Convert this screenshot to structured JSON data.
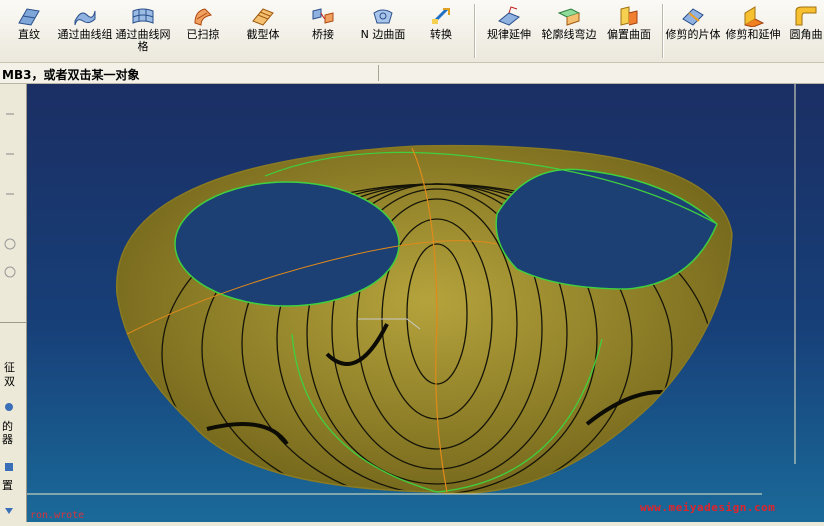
{
  "toolbar": {
    "ruled": "直纹",
    "through_curves": "通过曲线组",
    "through_curve_mesh": "通过曲线网格",
    "swept": "已扫掠",
    "section_body": "截型体",
    "bridge": "桥接",
    "n_sided": "N 边曲面",
    "transform": "转换",
    "law_extension": "规律延伸",
    "flange": "轮廓线弯边",
    "offset_surface": "偏置曲面",
    "trimmed_sheet": "修剪的片体",
    "trim_extend": "修剪和延伸",
    "face_blend": "圆角曲"
  },
  "cue_line": "MB3，或者双击某一对象",
  "leftbar": {
    "feature": "征",
    "feature2": "双",
    "of": "的",
    "of2": "器",
    "place": "置"
  },
  "watermark": "www.meiyadesign.com",
  "bottom_left_label": "ron.wrote",
  "colors": {
    "surface": "#6e6118",
    "surface_light": "#b5a33c",
    "edge_green": "#3fcf3f",
    "iso_orange": "#e08a1a",
    "background_top": "#1b2f64",
    "background_bottom": "#1a6a99"
  }
}
